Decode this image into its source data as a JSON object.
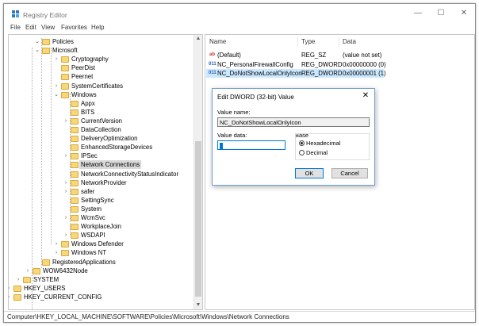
{
  "window": {
    "title": "Registry Editor",
    "minimize": "—",
    "maximize": "☐",
    "close": "✕"
  },
  "menu": [
    "File",
    "Edit",
    "View",
    "Favorites",
    "Help"
  ],
  "tree": [
    {
      "label": "Policies",
      "arrow": "v"
    },
    {
      "label": "Microsoft",
      "arrow": "v"
    },
    {
      "label": "Cryptography",
      "arrow": ">"
    },
    {
      "label": "PeerDist",
      "arrow": ""
    },
    {
      "label": "Peernet",
      "arrow": ""
    },
    {
      "label": "SystemCertificates",
      "arrow": ">"
    },
    {
      "label": "Windows",
      "arrow": "v"
    },
    {
      "label": "Appx",
      "arrow": ""
    },
    {
      "label": "BITS",
      "arrow": ""
    },
    {
      "label": "CurrentVersion",
      "arrow": ">"
    },
    {
      "label": "DataCollection",
      "arrow": ""
    },
    {
      "label": "DeliveryOptimization",
      "arrow": ""
    },
    {
      "label": "EnhancedStorageDevices",
      "arrow": ""
    },
    {
      "label": "IPSec",
      "arrow": ">"
    },
    {
      "label": "Network Connections",
      "arrow": ""
    },
    {
      "label": "NetworkConnectivityStatusIndicator",
      "arrow": ""
    },
    {
      "label": "NetworkProvider",
      "arrow": ">"
    },
    {
      "label": "safer",
      "arrow": ">"
    },
    {
      "label": "SettingSync",
      "arrow": ""
    },
    {
      "label": "System",
      "arrow": ""
    },
    {
      "label": "WcmSvc",
      "arrow": ">"
    },
    {
      "label": "WorkplaceJoin",
      "arrow": ""
    },
    {
      "label": "WSDAPI",
      "arrow": ">"
    },
    {
      "label": "Windows Defender",
      "arrow": ">"
    },
    {
      "label": "Windows NT",
      "arrow": ">"
    },
    {
      "label": "RegisteredApplications",
      "arrow": ""
    },
    {
      "label": "WOW6432Node",
      "arrow": ">"
    },
    {
      "label": "SYSTEM",
      "arrow": ">"
    },
    {
      "label": "HKEY_USERS",
      "arrow": ">"
    },
    {
      "label": "HKEY_CURRENT_CONFIG",
      "arrow": ">"
    }
  ],
  "list": {
    "headers": {
      "name": "Name",
      "type": "Type",
      "data": "Data"
    },
    "rows": [
      {
        "icon": "ab",
        "name": "(Default)",
        "type": "REG_SZ",
        "data": "(value not set)"
      },
      {
        "icon": "011",
        "name": "NC_PersonalFirewallConfig",
        "type": "REG_DWORD",
        "data": "0x00000000 (0)"
      },
      {
        "icon": "011",
        "name": "NC_DoNotShowLocalOnlyIcon",
        "type": "REG_DWORD",
        "data": "0x00000001 (1)"
      }
    ]
  },
  "dialog": {
    "title": "Edit DWORD (32-bit) Value",
    "close": "✕",
    "value_name_label": "Value name:",
    "value_name": "NC_DoNotShowLocalOnlyIcon",
    "value_data_label": "Value data:",
    "value_data": "1",
    "base_label": "Base",
    "hex_label": "Hexadecimal",
    "dec_label": "Decimal",
    "ok": "OK",
    "cancel": "Cancel"
  },
  "status": "Computer\\HKEY_LOCAL_MACHINE\\SOFTWARE\\Policies\\Microsoft\\Windows\\Network Connections",
  "colors": {
    "selection": "#cce8ff",
    "accent": "#0078d7",
    "folder": "#f7d77a"
  }
}
